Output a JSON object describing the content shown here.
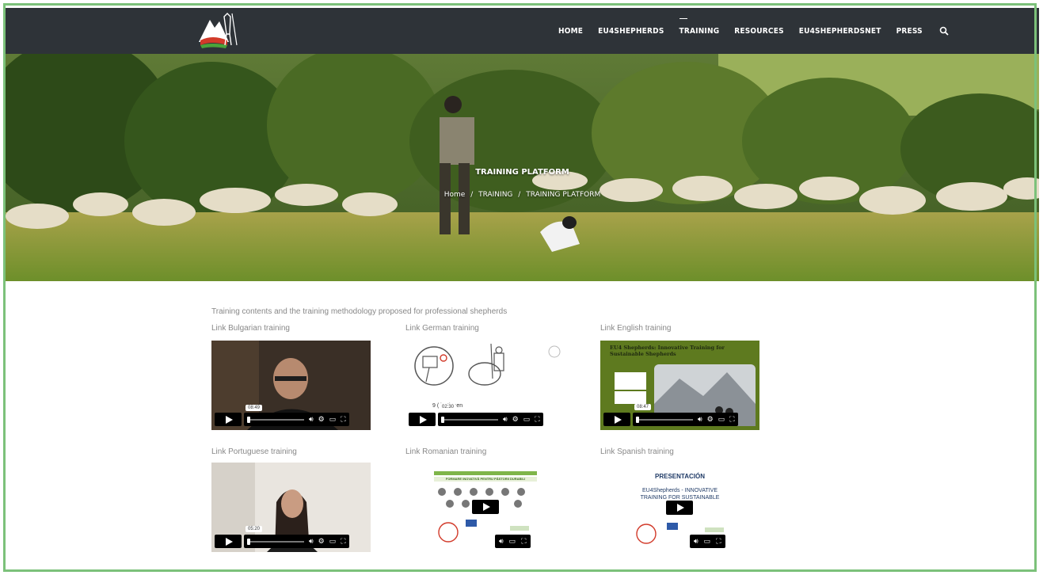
{
  "nav": {
    "items": [
      {
        "label": "HOME",
        "active": false
      },
      {
        "label": "EU4SHEPHERDS",
        "active": false
      },
      {
        "label": "TRAINING",
        "active": true
      },
      {
        "label": "RESOURCES",
        "active": false
      },
      {
        "label": "EU4SHEPHERDSNET",
        "active": false
      },
      {
        "label": "PRESS",
        "active": false
      }
    ]
  },
  "hero": {
    "title": "TRAINING PLATFORM",
    "breadcrumb": [
      "Home",
      "TRAINING",
      "TRAINING PLATFORM"
    ],
    "separator": "/"
  },
  "content": {
    "intro": "Training contents and the training methodology proposed for professional shepherds",
    "videos": [
      {
        "label": "Link Bulgarian training",
        "time": "08:49"
      },
      {
        "label": "Link German training",
        "time": "02:30",
        "overlay_text": "9 (     isationen"
      },
      {
        "label": "Link English training",
        "time": "08:47",
        "slide_title": "EU4 Shepherds: Innovative Training for Sustainable Shepherds"
      },
      {
        "label": "Link Portuguese training",
        "time": "05:20"
      },
      {
        "label": "Link Romanian training",
        "slide_title": "FORMARE INOVATIVĂ PENTRU PĂSTORII DURABILI"
      },
      {
        "label": "Link Spanish training",
        "slide_title": "PRESENTACIÓN",
        "slide_text": "EU4Shepherds - INNOVATIVE TRAINING FOR SUSTAINABLE S        S"
      }
    ]
  },
  "colors": {
    "nav_bg": "#2e3338",
    "frame": "#7cc17a",
    "text_muted": "#888888",
    "english_slide_bg": "#5e7a1f"
  }
}
